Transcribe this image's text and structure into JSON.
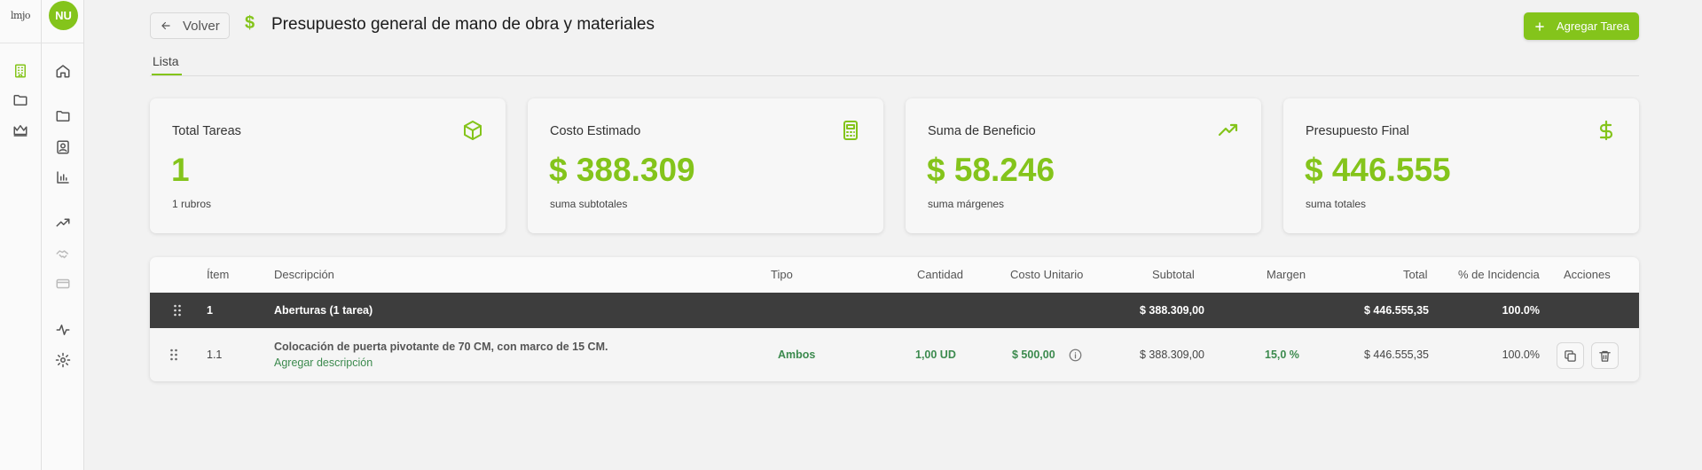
{
  "app": {
    "logo_text": "lmjo",
    "user_initials": "NU"
  },
  "header": {
    "back_label": "Volver",
    "title": "Presupuesto general de mano de obra y materiales",
    "add_task_label": "Agregar Tarea"
  },
  "tabs": [
    {
      "label": "Lista",
      "active": true
    }
  ],
  "cards": [
    {
      "label": "Total Tareas",
      "value": "1",
      "sub": "1 rubros",
      "icon": "box-icon"
    },
    {
      "label": "Costo Estimado",
      "value": "$ 388.309",
      "sub": "suma subtotales",
      "icon": "calculator-icon"
    },
    {
      "label": "Suma de Beneficio",
      "value": "$ 58.246",
      "sub": "suma márgenes",
      "icon": "trending-up-icon"
    },
    {
      "label": "Presupuesto Final",
      "value": "$ 446.555",
      "sub": "suma totales",
      "icon": "dollar-icon"
    }
  ],
  "table": {
    "headers": {
      "item": "Ítem",
      "descripcion": "Descripción",
      "tipo": "Tipo",
      "cantidad": "Cantidad",
      "costo_unitario": "Costo Unitario",
      "subtotal": "Subtotal",
      "margen": "Margen",
      "total": "Total",
      "incidencia": "% de Incidencia",
      "acciones": "Acciones"
    },
    "group": {
      "item": "1",
      "descripcion": "Aberturas (1 tarea)",
      "subtotal": "$ 388.309,00",
      "total": "$ 446.555,35",
      "incidencia": "100.0%"
    },
    "task": {
      "item": "1.1",
      "descripcion": "Colocación de puerta pivotante de 70 CM, con marco de 15 CM.",
      "add_description": "Agregar descripción",
      "tipo": "Ambos",
      "cantidad": "1,00 UD",
      "costo_unitario": "$ 500,00",
      "subtotal": "$ 388.309,00",
      "margen": "15,0 %",
      "total": "$ 446.555,35",
      "incidencia": "100.0%"
    }
  },
  "colors": {
    "accent": "#84c41b",
    "green_text": "#3c8a4e",
    "group_bg": "#3d3d3d"
  }
}
